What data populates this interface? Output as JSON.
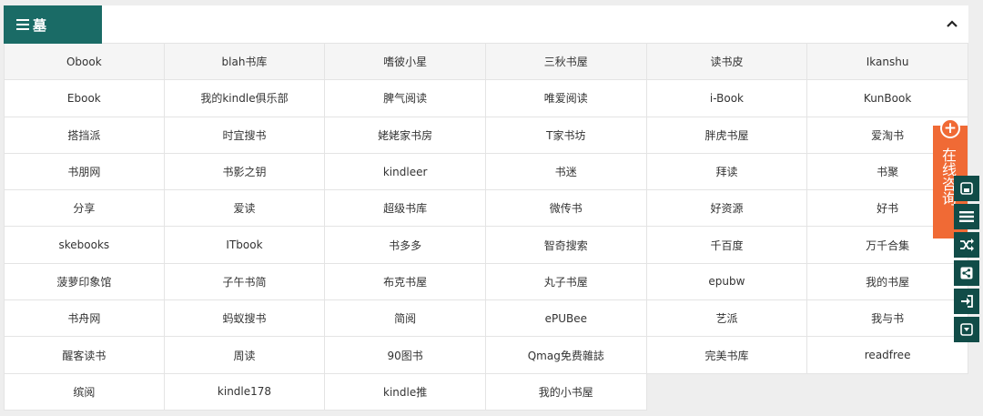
{
  "header": {
    "tab_label": "墓",
    "menu_icon": "menu-icon",
    "collapse_icon": "chevron-up-icon"
  },
  "grid": {
    "rows": [
      [
        "Obook",
        "blah书库",
        "嗜彼小星",
        "三秋书屋",
        "读书皮",
        "Ikanshu"
      ],
      [
        "Ebook",
        "我的kindle俱乐部",
        "脾气阅读",
        "唯爱阅读",
        "i-Book",
        "KunBook"
      ],
      [
        "搭挡派",
        "时宜搜书",
        "姥姥家书房",
        "T家书坊",
        "胖虎书屋",
        "爱淘书"
      ],
      [
        "书朋网",
        "书影之钥",
        "kindleer",
        "书迷",
        "拜读",
        "书聚"
      ],
      [
        "分享",
        "爱读",
        "超级书库",
        "微传书",
        "好资源",
        "好书"
      ],
      [
        "skebooks",
        "ITbook",
        "书多多",
        "智奇搜索",
        "千百度",
        "万千合集"
      ],
      [
        "菠萝印象馆",
        "子午书简",
        "布克书屋",
        "丸子书屋",
        "epubw",
        "我的书屋"
      ],
      [
        "书舟网",
        "蚂蚁搜书",
        "简阅",
        "ePUBee",
        "艺派",
        "我与书"
      ],
      [
        "醒客读书",
        "周读",
        "90图书",
        "Qmag免费雜誌",
        "完美书库",
        "readfree"
      ],
      [
        "缤阅",
        "kindle178",
        "kindle推",
        "我的小书屋"
      ]
    ]
  },
  "consult": {
    "plus": "+",
    "text": "在线咨询"
  },
  "toolbar": {
    "icons": [
      "save-icon",
      "list-icon",
      "shuffle-icon",
      "share-icon",
      "login-icon",
      "download-icon"
    ]
  },
  "colors": {
    "accent": "#1a6b66",
    "consult": "#f06a35",
    "toolbar": "#114c48"
  }
}
